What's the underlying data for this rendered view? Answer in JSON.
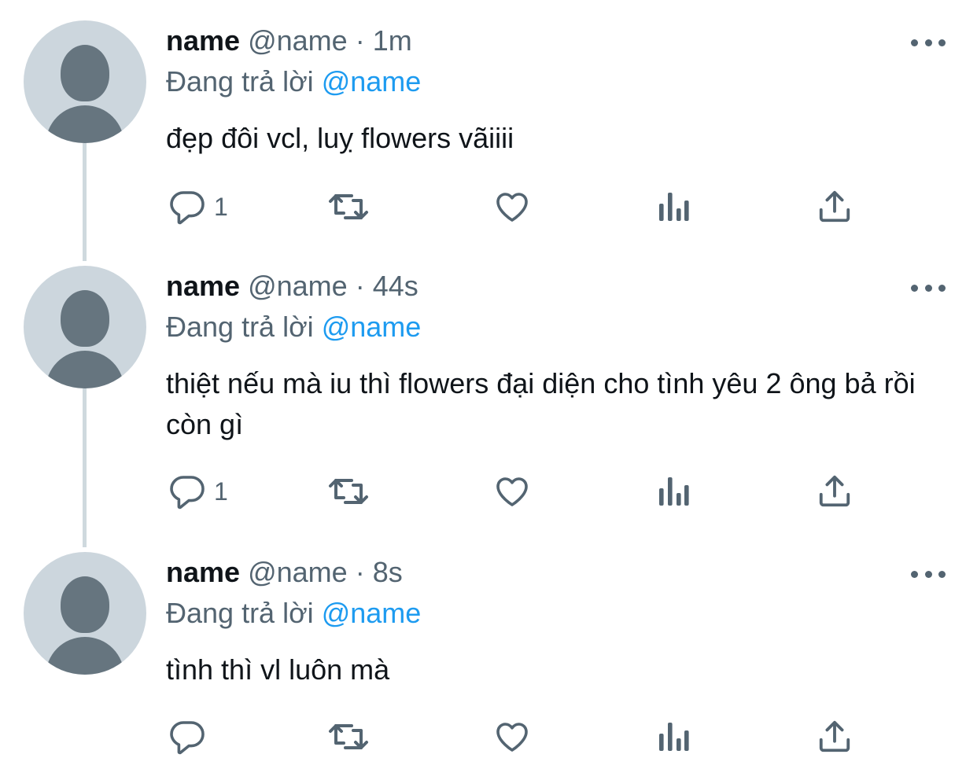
{
  "tweets": [
    {
      "name": "name",
      "handle": "@name",
      "separator": "·",
      "time": "1m",
      "replying_prefix": "Đang trả lời",
      "replying_to": "@name",
      "text": "đẹp đôi vcl, luỵ flowers vãiiii",
      "reply_count": "1"
    },
    {
      "name": "name",
      "handle": "@name",
      "separator": "·",
      "time": "44s",
      "replying_prefix": "Đang trả lời",
      "replying_to": "@name",
      "text": "thiệt nếu mà iu thì flowers đại diện cho tình yêu 2 ông bả rồi còn gì",
      "reply_count": "1"
    },
    {
      "name": "name",
      "handle": "@name",
      "separator": "·",
      "time": "8s",
      "replying_prefix": "Đang trả lời",
      "replying_to": "@name",
      "text": "tình thì vl luôn mà",
      "reply_count": ""
    }
  ],
  "icons": {
    "reply": "reply-icon",
    "retweet": "retweet-icon",
    "like": "heart-icon",
    "views": "analytics-icon",
    "share": "share-icon",
    "more": "more-icon"
  },
  "colors": {
    "text": "#0f1419",
    "secondary": "#536471",
    "mention": "#1d9bf0",
    "avatar_bg": "#ccd6dd",
    "avatar_fg": "#66757f",
    "thread_line": "#cfd9de"
  }
}
